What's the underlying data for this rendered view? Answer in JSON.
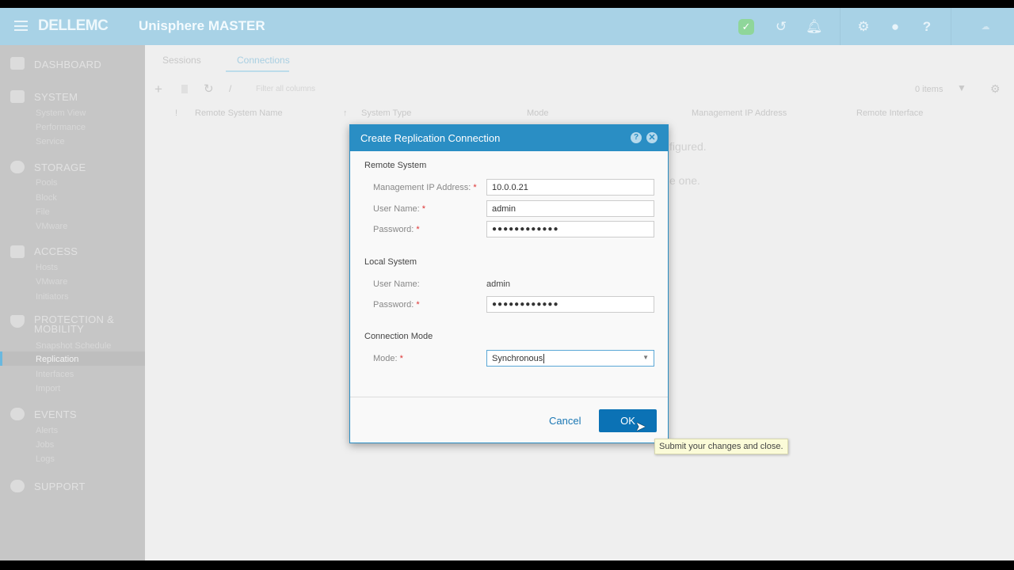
{
  "header": {
    "brand": "DELLEMC",
    "app_title": "Unisphere MASTER",
    "icons": [
      "menu-icon",
      "health-check-icon",
      "history-icon",
      "alerts-bell-icon",
      "settings-gear-icon",
      "user-icon",
      "help-icon",
      "cloudiq-logo"
    ]
  },
  "sidebar": {
    "sections": [
      {
        "label": "DASHBOARD",
        "icon": "dashboard-icon",
        "items": []
      },
      {
        "label": "SYSTEM",
        "icon": "system-icon",
        "items": [
          "System View",
          "Performance",
          "Service"
        ]
      },
      {
        "label": "STORAGE",
        "icon": "storage-icon",
        "items": [
          "Pools",
          "Block",
          "File",
          "VMware"
        ]
      },
      {
        "label": "ACCESS",
        "icon": "access-icon",
        "items": [
          "Hosts",
          "VMware",
          "Initiators"
        ]
      },
      {
        "label": "PROTECTION & MOBILITY",
        "icon": "shield-icon",
        "items": [
          "Snapshot Schedule",
          "Replication",
          "Interfaces",
          "Import"
        ]
      },
      {
        "label": "EVENTS",
        "icon": "events-icon",
        "items": [
          "Alerts",
          "Jobs",
          "Logs"
        ]
      },
      {
        "label": "SUPPORT",
        "icon": "support-icon",
        "items": []
      }
    ],
    "active_item": "Replication"
  },
  "main": {
    "tabs": [
      "Sessions",
      "Connections"
    ],
    "active_tab": "Connections",
    "filter_placeholder": "Filter all columns",
    "item_count": "0 items",
    "columns": [
      "!",
      "Remote System Name",
      "System Type",
      "Mode",
      "Management IP Address",
      "Remote Interface"
    ],
    "empty_fragment_1": "figured.",
    "empty_fragment_2": "e one."
  },
  "dialog": {
    "title": "Create Replication Connection",
    "remote_group": "Remote System",
    "remote_ip_label": "Management IP Address:",
    "remote_ip_value": "10.0.0.21",
    "remote_user_label": "User Name:",
    "remote_user_value": "admin",
    "remote_password_label": "Password:",
    "remote_password_value": "●●●●●●●●●●●●",
    "local_group": "Local System",
    "local_user_label": "User Name:",
    "local_user_value": "admin",
    "local_password_label": "Password:",
    "local_password_value": "●●●●●●●●●●●●",
    "mode_group": "Connection Mode",
    "mode_label": "Mode:",
    "mode_value": "Synchronous",
    "required_mark": "*",
    "cancel_label": "Cancel",
    "ok_label": "OK",
    "tooltip": "Submit your changes and close."
  },
  "colors": {
    "header": "#a8d2e6",
    "dialog_title": "#2a8ec4",
    "ok_button": "#0b72b5",
    "required": "#dd3333",
    "tooltip_bg": "#fbfbd8"
  }
}
